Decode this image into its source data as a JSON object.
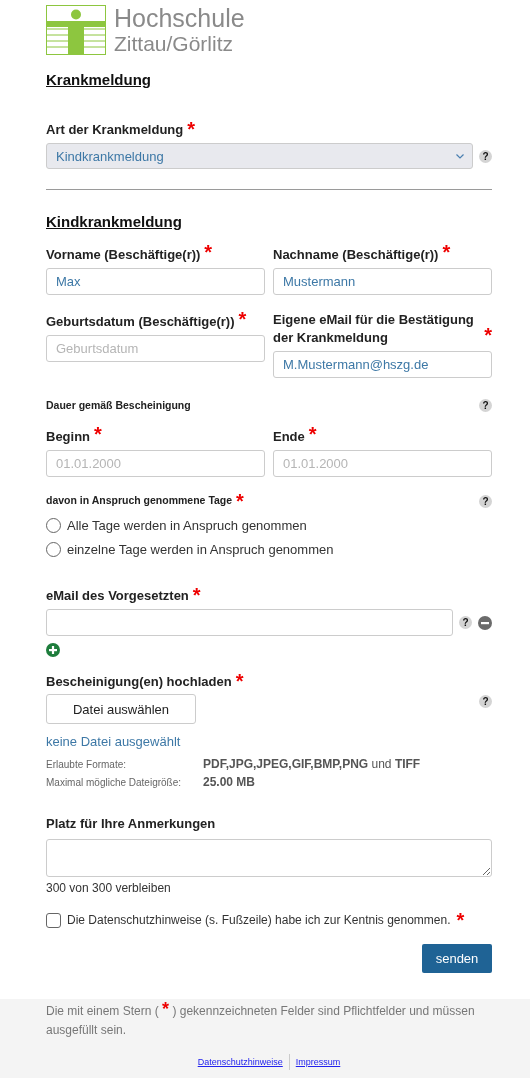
{
  "logo": {
    "line1": "Hochschule",
    "line2": "Zittau/Görlitz"
  },
  "page_title": "Krankmeldung",
  "type_field": {
    "label": "Art der Krankmeldung",
    "required_mark": "*",
    "value": "Kindkrankmeldung",
    "help": "?"
  },
  "section_title": "Kindkrankmeldung",
  "person_fields": [
    {
      "label": "Vorname (Beschäftige(r))",
      "required_mark": "*",
      "value": "Max"
    },
    {
      "label": "Nachname (Beschäftige(r))",
      "required_mark": "*",
      "value": "Mustermann"
    },
    {
      "label": "Geburtsdatum (Beschäftige(r))",
      "required_mark": "*",
      "placeholder": "Geburtsdatum"
    },
    {
      "label": "Eigene eMail für die Bestätigung der Krankmeldung",
      "required_mark": "*",
      "value": "M.Mustermann@hszg.de"
    }
  ],
  "duration": {
    "label": "Dauer gemäß Bescheinigung",
    "help": "?",
    "fields": [
      {
        "label": "Beginn",
        "required_mark": "*",
        "placeholder": "01.01.2000"
      },
      {
        "label": "Ende",
        "required_mark": "*",
        "placeholder": "01.01.2000"
      }
    ]
  },
  "days": {
    "label": "davon in Anspruch genommene Tage",
    "required_mark": "*",
    "help": "?",
    "options": [
      {
        "label": "Alle Tage werden in Anspruch genommen",
        "selected": false
      },
      {
        "label": "einzelne Tage werden in Anspruch genommen",
        "selected": false
      }
    ]
  },
  "supervisor": {
    "label": "eMail des Vorgesetzten",
    "required_mark": "*",
    "help": "?"
  },
  "upload": {
    "label": "Bescheinigung(en) hochladen",
    "required_mark": "*",
    "button": "Datei auswählen",
    "help": "?",
    "status": "keine Datei ausgewählt",
    "info": [
      {
        "label": "Erlaubte Formate:",
        "value": "**PDF,JPG,JPEG,GIF,BMP,PNG** und **TIFF**",
        "bold": false
      },
      {
        "label": "Maximal mögliche Dateigröße:",
        "value": "25.00 MB",
        "bold": true
      }
    ]
  },
  "remarks": {
    "label": "Platz für Ihre Anmerkungen",
    "counter": "300 von 300 verbleiben"
  },
  "consent": {
    "label": "Die Datenschutzhinweise (s. Fußzeile) habe ich zur Kentnis genommen.",
    "required_mark": "*",
    "checked": false
  },
  "submit": "senden",
  "footer": {
    "note_before": "Die mit einem Stern (",
    "note_mark": "*",
    "note_after": ") gekennzeichneten Felder sind Pflichtfelder und müssen ausgefüllt sein.",
    "links": [
      "Datenschutzhinweise",
      "Impressum"
    ]
  }
}
